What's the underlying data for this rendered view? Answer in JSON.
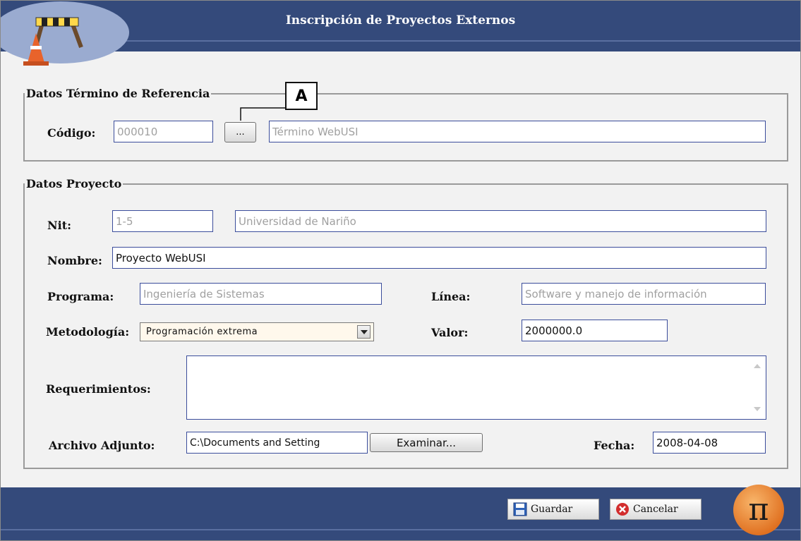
{
  "header": {
    "title": "Inscripción de Proyectos Externos",
    "logo_icon": "road-barrier-cone-icon"
  },
  "callout": {
    "label": "A"
  },
  "ref_section": {
    "legend": "Datos Término de Referencia",
    "codigo_label": "Código:",
    "codigo_value": "000010",
    "browse_button_label": "...",
    "termino_value": "Término WebUSI"
  },
  "project_section": {
    "legend": "Datos Proyecto",
    "nit_label": "Nit:",
    "nit_value": "1-5",
    "entidad_value": "Universidad de Nariño",
    "nombre_label": "Nombre:",
    "nombre_value": "Proyecto WebUSI",
    "programa_label": "Programa:",
    "programa_value": "Ingeniería de Sistemas",
    "linea_label": "Línea:",
    "linea_value": "Software y manejo de información",
    "metodologia_label": "Metodología:",
    "metodologia_value": "Programación extrema",
    "valor_label": "Valor:",
    "valor_value": "2000000.0",
    "requerimientos_label": "Requerimientos:",
    "requerimientos_value": "",
    "archivo_label": "Archivo Adjunto:",
    "archivo_value": "C:\\Documents and Setting",
    "examinar_label": "Examinar...",
    "fecha_label": "Fecha:",
    "fecha_value": "2008-04-08"
  },
  "footer": {
    "guardar_label": "Guardar",
    "cancelar_label": "Cancelar",
    "guardar_icon": "save-floppy-icon",
    "cancelar_icon": "cancel-x-icon",
    "pi_logo_icon": "pi-logo-icon"
  },
  "colors": {
    "header_blue": "#344a7b",
    "field_border": "#3b4d9b",
    "background": "#f2f2f2",
    "pi_orange": "#e57c2e"
  }
}
